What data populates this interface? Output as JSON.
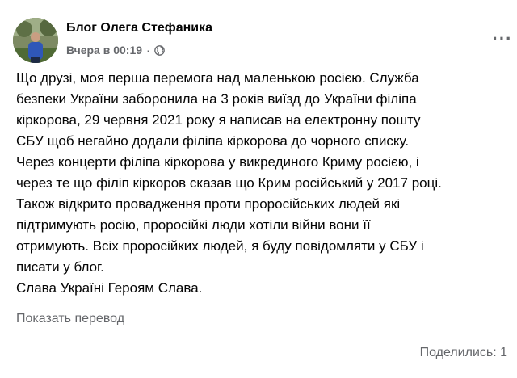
{
  "post": {
    "author": "Блог Олега Стефаника",
    "time": "Вчера в 00:19",
    "separator": "·",
    "body_lines": [
      "Що друзі, моя перша  перемога над маленькою росією. Служба",
      "безпеки України заборонила на 3 років виїзд до України філіпа",
      "кіркорова, 29 червня 2021 року я написав на електронну пошту",
      "СБУ щоб негайно додали філіпа кіркорова до чорного списку.",
      "Через концерти філіпа кіркорова у  викрединого Криму росією, і",
      "через те що філіп кіркоров сказав що Крим російський у 2017 році.",
      "Також відкрито провадження проти проросійських людей які",
      "підтримують росію, проросійкі люди хотіли війни вони її",
      "отримують. Всіх проросійких людей, я буду повідомляти у СБУ і",
      "писати у блог.",
      "Слава Україні Героям Слава."
    ],
    "translate_label": "Показать перевод",
    "shares_label": "Поделились: 1"
  },
  "icons": {
    "more": "more-options-icon",
    "audience": "globe-icon",
    "avatar": "profile-photo"
  },
  "colors": {
    "text_primary": "#050505",
    "text_secondary": "#65676b",
    "background": "#ffffff"
  }
}
